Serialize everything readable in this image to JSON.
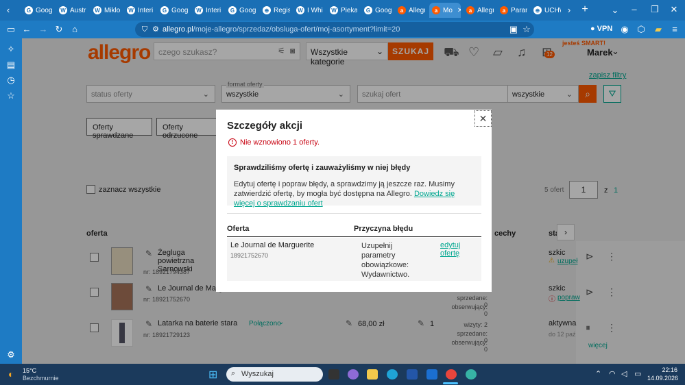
{
  "browser": {
    "tabs": [
      {
        "label": "Goog"
      },
      {
        "label": "Austr"
      },
      {
        "label": "Miklo"
      },
      {
        "label": "Interi"
      },
      {
        "label": "Goog"
      },
      {
        "label": "Interi"
      },
      {
        "label": "Goog"
      },
      {
        "label": "Regis"
      },
      {
        "label": "I Whi"
      },
      {
        "label": "Piekar"
      },
      {
        "label": "Goog"
      },
      {
        "label": "Allegr"
      },
      {
        "label": "Mo",
        "active": true
      },
      {
        "label": "Allegr"
      },
      {
        "label": "Param"
      },
      {
        "label": "UCHW"
      }
    ],
    "url_host": "allegro.pl",
    "url_path": "/moje-allegro/sprzedaz/obsluga-ofert/moj-asortyment?limit=20",
    "vpn_label": "VPN"
  },
  "header": {
    "logo": "allegro",
    "search_placeholder": "czego szukasz?",
    "category": "Wszystkie kategorie",
    "search_button": "SZUKAJ",
    "cart_count": "12",
    "smart_label": "jesteś SMART!",
    "user_name": "Marek"
  },
  "filters": {
    "save_filters": "zapisz filtry",
    "status_placeholder": "status oferty",
    "format_label": "format oferty",
    "format_value": "wszystkie",
    "search_offers_placeholder": "szukaj ofert",
    "search_scope": "wszystkie",
    "btn_checked": "Oferty sprawdzane",
    "btn_rejected": "Oferty odrzucone"
  },
  "list": {
    "select_all": "zaznacz wszystkie",
    "count": "5 ofert",
    "page": "1",
    "page_of": "z",
    "page_total": "1",
    "col_offer": "oferta",
    "col_features": "cechy",
    "col_status": "statu",
    "rows": [
      {
        "title": "Żegluga powietrzna Sarnowski",
        "nr": "nr: 18921794387",
        "status": "szkic",
        "status_link": "uzupeł"
      },
      {
        "title": "Le Journal de Margu",
        "nr": "nr: 18921752670",
        "status": "szkic",
        "status_link": "popraw",
        "sold": "sprzedane: 0",
        "watch": "obserwujący: 0"
      },
      {
        "title": "Latarka na baterie stara",
        "nr": "nr: 18921729123",
        "connected": "Połączono",
        "price": "68,00 zł",
        "qty": "1",
        "visits": "wizyty: 2",
        "sold": "sprzedane: 0",
        "watch": "obserwujący: 0",
        "status": "aktywna",
        "until": "do 12 paź",
        "more": "więcej"
      }
    ]
  },
  "modal": {
    "title": "Szczegóły akcji",
    "error": "Nie wznowiono 1 oferty.",
    "info_title": "Sprawdziliśmy ofertę i zauważyliśmy w niej błędy",
    "info_text": "Edytuj ofertę i popraw błędy, a sprawdzimy ją jeszcze raz. Musimy zatwierdzić ofertę, by mogła być dostępna na Allegro.",
    "info_link": "Dowiedz się więcej o sprawdzaniu ofert",
    "col_offer": "Oferta",
    "col_reason": "Przyczyna błędu",
    "row_title": "Le Journal de Marguerite",
    "row_nr": "18921752670",
    "row_reason": "Uzupełnij parametry obowiązkowe: Wydawnictwo.",
    "row_action": "edytuj ofertę"
  },
  "taskbar": {
    "temp": "15°C",
    "weather": "Bezchmurnie",
    "search": "Wyszukaj",
    "time": "22:16",
    "date": "14.09.2026"
  }
}
